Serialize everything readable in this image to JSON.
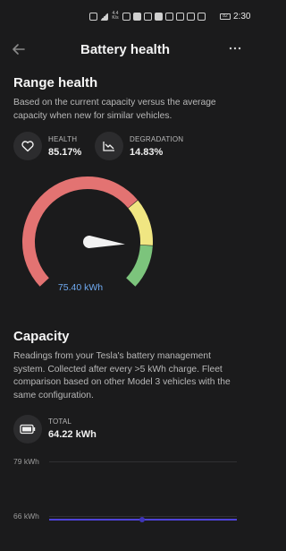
{
  "status_bar": {
    "time": "2:30",
    "rate": "4.4 K/s",
    "battery": "82"
  },
  "header": {
    "title": "Battery health"
  },
  "range_health": {
    "title": "Range health",
    "description": "Based on the current capacity versus the average capacity when new for similar vehicles.",
    "health_label": "HEALTH",
    "health_value": "85.17%",
    "degradation_label": "DEGRADATION",
    "degradation_value": "14.83%",
    "gauge_value": "75.40 kWh",
    "gauge_level": 0.8517,
    "colors": {
      "red": "#e37372",
      "yellow": "#f0e682",
      "green": "#7cc47c",
      "needle": "#f2f2f2",
      "value": "#6fa9f0"
    }
  },
  "capacity": {
    "title": "Capacity",
    "description": "Readings from your Tesla's battery management system. Collected after every >5 kWh charge. Fleet comparison based on other Model 3 vehicles with the same configuration.",
    "total_label": "TOTAL",
    "total_value": "64.22 kWh",
    "chart_label_high": "79 kWh",
    "chart_label_low": "66 kWh",
    "line_color": "#4f43d8"
  },
  "icons": {
    "back": "arrow-left-icon",
    "more": "more-icon",
    "health": "heart-icon",
    "degradation": "trend-down-icon",
    "total": "battery-icon"
  }
}
